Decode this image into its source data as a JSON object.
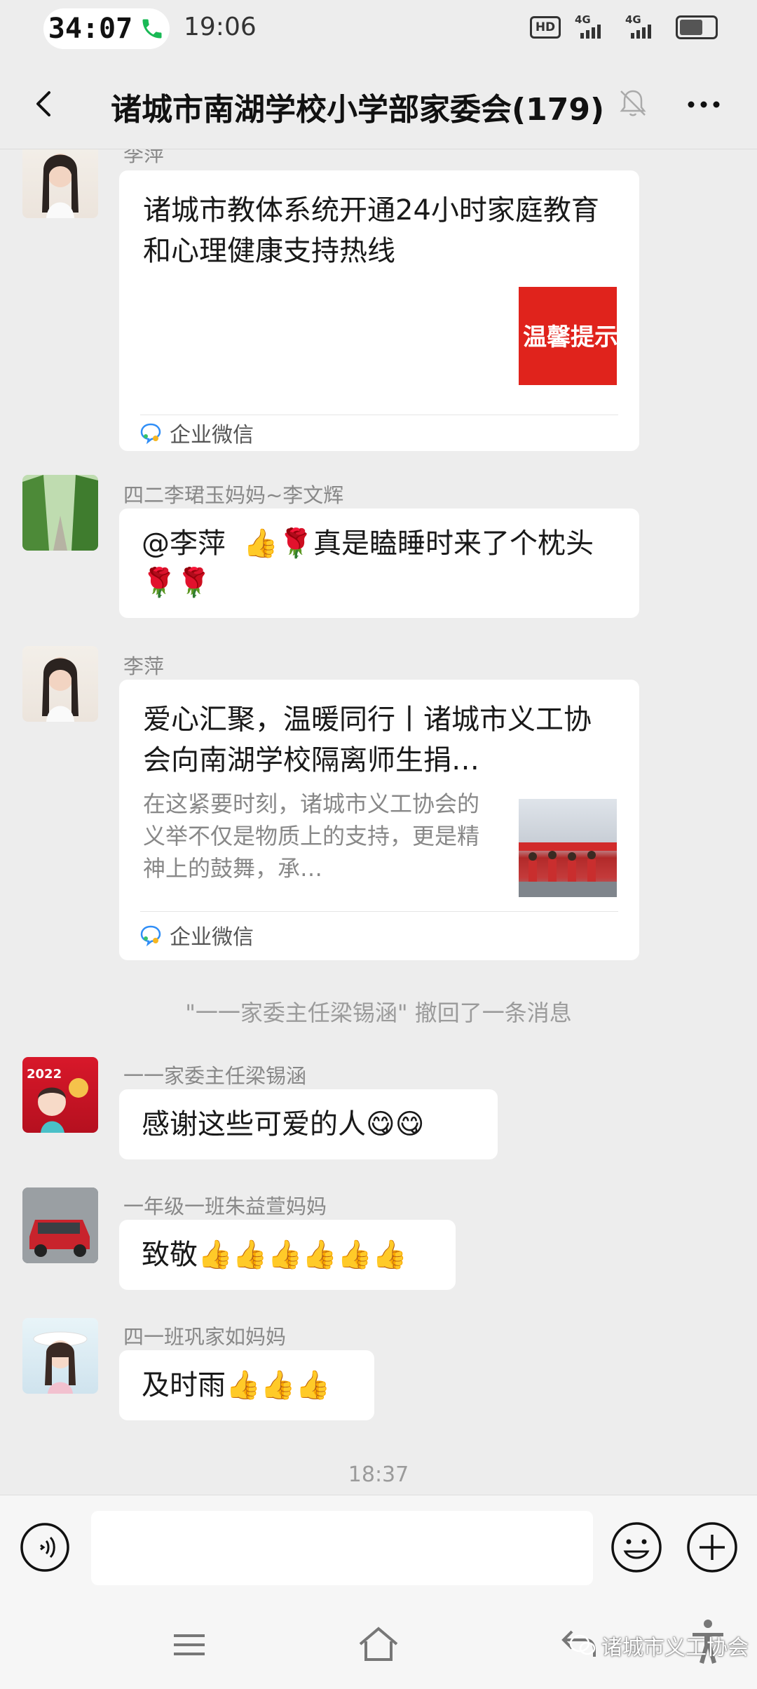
{
  "status_bar": {
    "call_timer": "34:07",
    "clock": "19:06",
    "hd_label": "HD",
    "network_1": "4G",
    "network_2": "4G"
  },
  "header": {
    "title": "诸城市南湖学校小学部家委会(179)"
  },
  "messages": [
    {
      "sender": "李萍",
      "card_title": "诸城市教体系统开通24小时家庭教育和心理健康支持热线",
      "thumb_text": "温馨提示",
      "source": "企业微信"
    },
    {
      "sender": "四二李珺玉妈妈~李文辉",
      "text": "@李萍  👍🌹真是瞌睡时来了个枕头🌹🌹"
    },
    {
      "sender": "李萍",
      "card_title": "爱心汇聚，温暖同行丨诸城市义工协会向南湖学校隔离师生捐…",
      "card_desc": "在这紧要时刻，诸城市义工协会的义举不仅是物质上的支持，更是精神上的鼓舞，承…",
      "source": "企业微信"
    },
    {
      "system": "\"一一家委主任梁锡涵\" 撤回了一条消息"
    },
    {
      "sender": "一一家委主任梁锡涵",
      "text": "感谢这些可爱的人😋😋",
      "avatar_text": "2022"
    },
    {
      "sender": "一年级一班朱益萱妈妈",
      "text": "致敬👍👍👍👍👍👍"
    },
    {
      "sender": "四一班巩家如妈妈",
      "text": "及时雨👍👍👍"
    }
  ],
  "time_separator": "18:37",
  "watermark": "诸城市义工协会",
  "colors": {
    "background": "#ededed",
    "bubble": "#ffffff",
    "thumb_red": "#e0231c"
  }
}
